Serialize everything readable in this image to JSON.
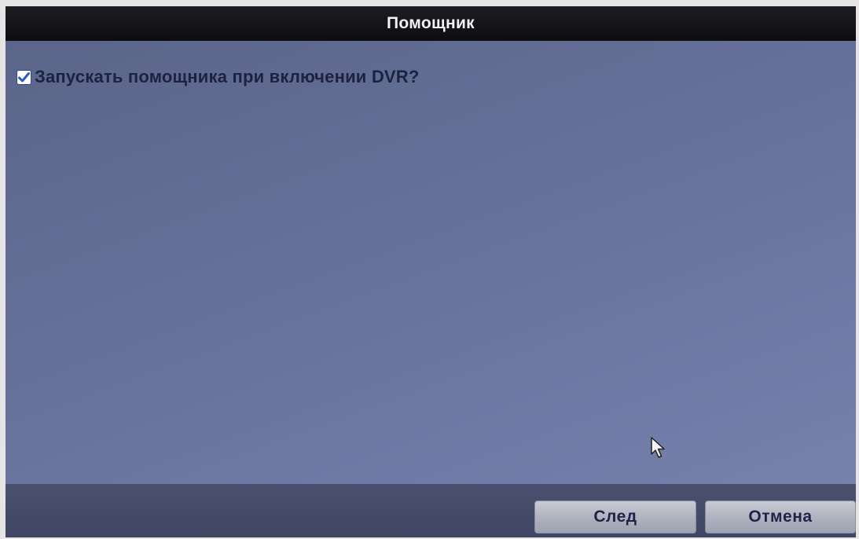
{
  "dialog": {
    "title": "Помощник"
  },
  "option": {
    "label": "Запускать помощника при включении DVR?",
    "checked": true
  },
  "buttons": {
    "next_label": "След",
    "cancel_label": "Отмена"
  },
  "colors": {
    "titlebar": "#111215",
    "panel": "#66719a",
    "footer": "#454c69",
    "text": "#1c2240",
    "checkmark": "#2d5bc4"
  },
  "icons": {
    "checkbox": "checkbox-checked-icon",
    "cursor": "mouse-pointer-icon"
  }
}
